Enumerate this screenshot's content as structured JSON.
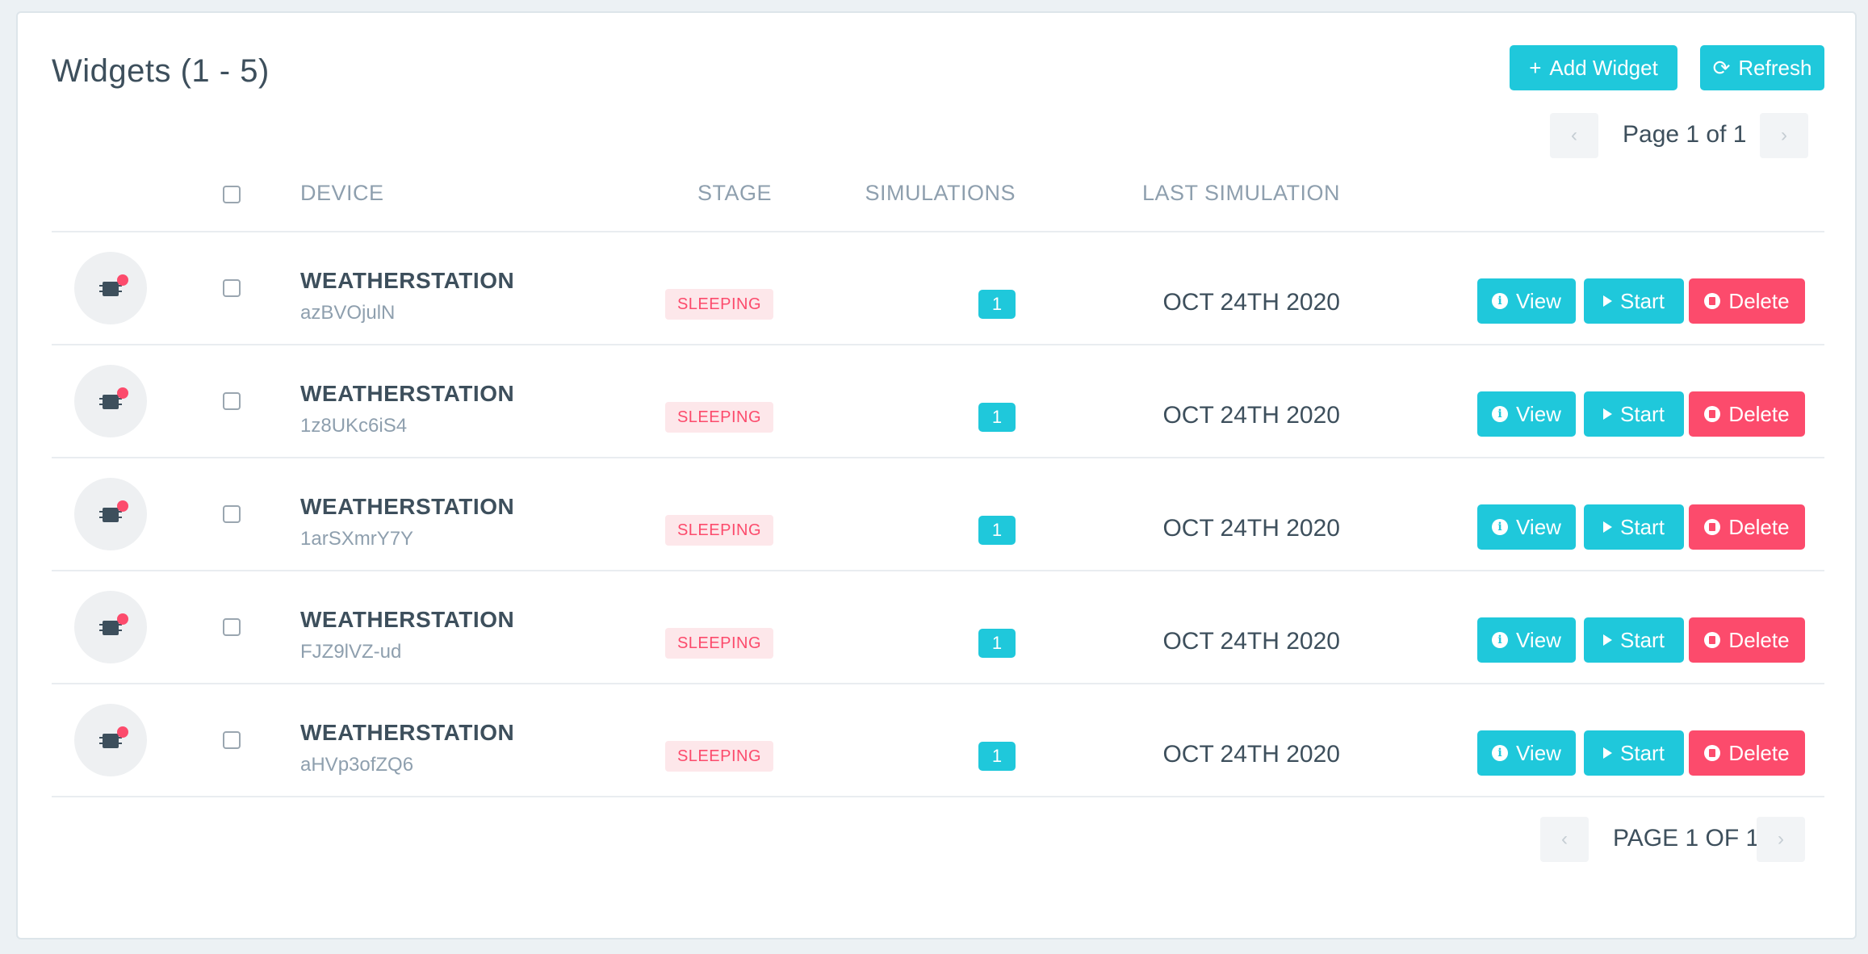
{
  "header": {
    "title": "Widgets (1 - 5)",
    "add_label": "Add Widget",
    "add_icon": "+",
    "refresh_label": "Refresh",
    "refresh_icon": "⟳"
  },
  "pagination_top": {
    "label": "Page 1 of 1",
    "prev": "‹",
    "next": "›"
  },
  "pagination_bottom": {
    "label": "PAGE 1 OF 1",
    "prev": "‹",
    "next": "›"
  },
  "columns": {
    "device": "DEVICE",
    "stage": "STAGE",
    "simulations": "SIMULATIONS",
    "last_simulation": "LAST SIMULATION"
  },
  "rows": [
    {
      "device": "WEATHERSTATION",
      "id": "azBVOjulN",
      "stage": "SLEEPING",
      "simulations": "1",
      "last_simulation": "OCT 24TH 2020"
    },
    {
      "device": "WEATHERSTATION",
      "id": "1z8UKc6iS4",
      "stage": "SLEEPING",
      "simulations": "1",
      "last_simulation": "OCT 24TH 2020"
    },
    {
      "device": "WEATHERSTATION",
      "id": "1arSXmrY7Y",
      "stage": "SLEEPING",
      "simulations": "1",
      "last_simulation": "OCT 24TH 2020"
    },
    {
      "device": "WEATHERSTATION",
      "id": "FJZ9lVZ-ud",
      "stage": "SLEEPING",
      "simulations": "1",
      "last_simulation": "OCT 24TH 2020"
    },
    {
      "device": "WEATHERSTATION",
      "id": "aHVp3ofZQ6",
      "stage": "SLEEPING",
      "simulations": "1",
      "last_simulation": "OCT 24TH 2020"
    }
  ],
  "row_actions": {
    "view": "View",
    "start": "Start",
    "delete": "Delete"
  },
  "colors": {
    "accent": "#1fc8db",
    "danger": "#fc4b6c",
    "stage_bg": "#fde7ea"
  }
}
